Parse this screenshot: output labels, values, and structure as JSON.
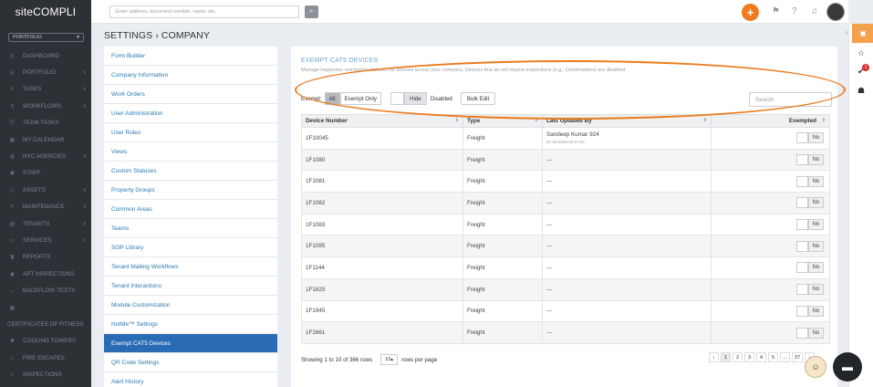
{
  "sidebar": {
    "logo": "siteCOMPLI",
    "portfolio_label": "PORTFOLIO",
    "items": [
      {
        "label": "DASHBOARD",
        "icon": "dashboard-icon",
        "chev": false
      },
      {
        "label": "PORTFOLIO",
        "icon": "map-pin-icon",
        "chev": true
      },
      {
        "label": "TASKS",
        "icon": "list-icon",
        "chev": true
      },
      {
        "label": "WORKFLOWS",
        "icon": "workflow-icon",
        "chev": true
      },
      {
        "label": "TEAM TASKS",
        "icon": "team-icon",
        "chev": false
      },
      {
        "label": "MY CALENDAR",
        "icon": "calendar-icon",
        "chev": false
      },
      {
        "label": "NYC AGENCIES",
        "icon": "agency-icon",
        "chev": true
      },
      {
        "label": "STAFF",
        "icon": "staff-icon",
        "chev": false
      },
      {
        "label": "ASSETS",
        "icon": "assets-icon",
        "chev": true
      },
      {
        "label": "MAINTENANCE",
        "icon": "wrench-icon",
        "chev": true
      },
      {
        "label": "TENANTS",
        "icon": "tenants-icon",
        "chev": true
      },
      {
        "label": "SERVICES",
        "icon": "services-icon",
        "chev": true
      },
      {
        "label": "REPORTS",
        "icon": "reports-icon",
        "chev": false
      },
      {
        "label": "APT INSPECTIONS",
        "icon": "eye-icon",
        "chev": false
      },
      {
        "label": "BACKFLOW TESTS",
        "icon": "backflow-icon",
        "chev": false
      },
      {
        "label": "",
        "icon": "grid-icon",
        "chev": false
      },
      {
        "label": "CERTIFICATES OF FITNESS",
        "icon": "",
        "chev": false
      },
      {
        "label": "COOLING TOWERS",
        "icon": "fan-icon",
        "chev": false
      },
      {
        "label": "FIRE ESCAPES",
        "icon": "fire-icon",
        "chev": false
      },
      {
        "label": "INSPECTIONS",
        "icon": "inspect-icon",
        "chev": false
      }
    ]
  },
  "topbar": {
    "search_placeholder": "Enter address, document number, name, etc."
  },
  "page_title": "SETTINGS › COMPANY",
  "settings_menu": [
    "Form Builder",
    "Company Information",
    "Work Orders",
    "User Administration",
    "User Roles",
    "Views",
    "Custom Statuses",
    "Property Groups",
    "Common Areas",
    "Teams",
    "SOP Library",
    "Tenant Mailing Workflows",
    "Tenant Interactions",
    "Module Customization",
    "NotMe™ Settings",
    "Exempt CAT5 Devices",
    "QR Code Settings",
    "Alert History"
  ],
  "active_menu_index": 15,
  "content": {
    "title": "EXEMPT CAT5 DEVICES",
    "description": "Manage inspection exemption statuses for devices across your company. Devices that do not require inspections (e.g., Dumbwaiters) are disabled.",
    "exempt_label": "Exempt:",
    "seg_all": "All",
    "seg_exempt_only": "Exempt Only",
    "hide_label": "Hide",
    "disabled_label": "Disabled",
    "bulk_edit": "Bulk Edit",
    "search_placeholder": "Search",
    "columns": [
      "Device Number",
      "Type",
      "Last Updated By",
      "Exempted"
    ],
    "rows": [
      {
        "device": "1F10045",
        "type": "Freight",
        "updated_by": "Sandeep Kumar 924",
        "updated_at": "07-16-2026 00:27:04",
        "exempted": "No"
      },
      {
        "device": "1F1080",
        "type": "Freight",
        "updated_by": "---",
        "updated_at": "",
        "exempted": "No"
      },
      {
        "device": "1F1081",
        "type": "Freight",
        "updated_by": "---",
        "updated_at": "",
        "exempted": "No"
      },
      {
        "device": "1F1082",
        "type": "Freight",
        "updated_by": "---",
        "updated_at": "",
        "exempted": "No"
      },
      {
        "device": "1F1083",
        "type": "Freight",
        "updated_by": "---",
        "updated_at": "",
        "exempted": "No"
      },
      {
        "device": "1F1095",
        "type": "Freight",
        "updated_by": "---",
        "updated_at": "",
        "exempted": "No"
      },
      {
        "device": "1F1144",
        "type": "Freight",
        "updated_by": "---",
        "updated_at": "",
        "exempted": "No"
      },
      {
        "device": "1F1825",
        "type": "Freight",
        "updated_by": "---",
        "updated_at": "",
        "exempted": "No"
      },
      {
        "device": "1F1945",
        "type": "Freight",
        "updated_by": "---",
        "updated_at": "",
        "exempted": "No"
      },
      {
        "device": "1F2661",
        "type": "Freight",
        "updated_by": "---",
        "updated_at": "",
        "exempted": "No"
      }
    ],
    "footer_showing": "Showing 1 to 10 of 366 rows",
    "rows_per_page_value": "10",
    "rows_per_page_label": "rows per page",
    "pagination": [
      "‹",
      "1",
      "2",
      "3",
      "4",
      "5",
      "...",
      "37",
      "›"
    ]
  },
  "colors": {
    "accent": "#f07b1f",
    "active_menu": "#2a6bb6",
    "highlight": "#ec7a1c"
  }
}
